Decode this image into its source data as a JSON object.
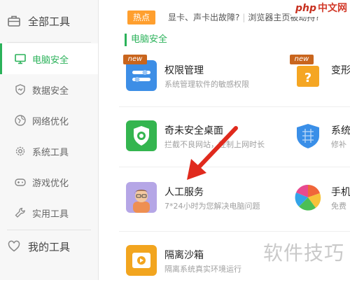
{
  "sidebar": {
    "header_label": "全部工具",
    "items": [
      {
        "label": "电脑安全",
        "icon": "monitor-icon",
        "active": true
      },
      {
        "label": "数据安全",
        "icon": "shield-icon",
        "active": false
      },
      {
        "label": "网络优化",
        "icon": "globe-icon",
        "active": false
      },
      {
        "label": "系统工具",
        "icon": "gear-icon",
        "active": false
      },
      {
        "label": "游戏优化",
        "icon": "gamepad-icon",
        "active": false
      },
      {
        "label": "实用工具",
        "icon": "wrench-icon",
        "active": false
      }
    ],
    "footer_label": "我的工具"
  },
  "topbar": {
    "hot_label": "热点",
    "news": [
      "显卡、声卡出故障?",
      "浏览器主页被劫持?"
    ]
  },
  "section": {
    "title": "电脑安全"
  },
  "tools": [
    {
      "name": "权限管理",
      "desc": "系统管理软件的敏感权限",
      "badge": "new",
      "icon": "toggle-settings-icon",
      "color": "#3d8ee6"
    },
    {
      "name": "变形",
      "desc": "",
      "badge": "new",
      "icon": "question-box-icon",
      "color": "#f5a623"
    },
    {
      "name": "奇未安全桌面",
      "desc": "拦截不良网站，控制上网时长",
      "badge": "",
      "icon": "shield-plus-icon",
      "color": "#34b54f"
    },
    {
      "name": "系统",
      "desc": "修补",
      "badge": "",
      "icon": "shield-grid-icon",
      "color": "#3a8fe8"
    },
    {
      "name": "人工服务",
      "desc": "7*24小时为您解决电脑问题",
      "badge": "",
      "icon": "person-avatar-icon",
      "color": "#b5a6e6"
    },
    {
      "name": "手机",
      "desc": "免费",
      "badge": "",
      "icon": "color-wheel-icon",
      "color": "#f0663a"
    },
    {
      "name": "隔离沙箱",
      "desc": "隔离系统真实环境运行",
      "badge": "",
      "icon": "sandbox-icon",
      "color": "#f2a51f"
    }
  ],
  "watermark": {
    "top_logo": "php",
    "top_text": "中文网",
    "bottom_text": "软件技巧"
  },
  "colors": {
    "accent": "#2bb25a",
    "hot": "#ff9f2e",
    "arrow": "#e02a1d"
  }
}
